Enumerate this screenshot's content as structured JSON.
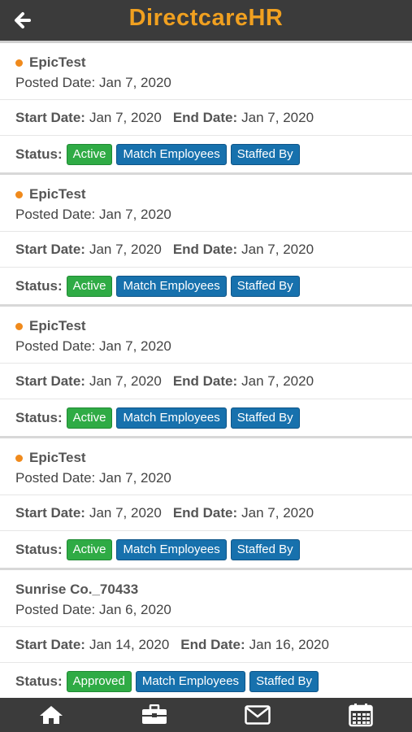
{
  "header": {
    "title": "DirectcareHR",
    "back_icon": "arrow-left-icon"
  },
  "labels": {
    "posted_prefix": "Posted Date:",
    "start_label": "Start Date:",
    "end_label": "End Date:",
    "status_label": "Status:",
    "match_employees": "Match Employees",
    "staffed_by": "Staffed By"
  },
  "jobs": [
    {
      "name": "EpicTest",
      "posted": "Jan 7, 2020",
      "start": "Jan 7, 2020",
      "end": "Jan 7, 2020",
      "status": "Active"
    },
    {
      "name": "EpicTest",
      "posted": "Jan 7, 2020",
      "start": "Jan 7, 2020",
      "end": "Jan 7, 2020",
      "status": "Active"
    },
    {
      "name": "EpicTest",
      "posted": "Jan 7, 2020",
      "start": "Jan 7, 2020",
      "end": "Jan 7, 2020",
      "status": "Active"
    },
    {
      "name": "EpicTest",
      "posted": "Jan 7, 2020",
      "start": "Jan 7, 2020",
      "end": "Jan 7, 2020",
      "status": "Active"
    },
    {
      "name": "Sunrise Co._70433",
      "posted": "Jan 6, 2020",
      "start": "Jan 14, 2020",
      "end": "Jan 16, 2020",
      "status": "Approved"
    }
  ],
  "nav": [
    "home-icon",
    "briefcase-icon",
    "mail-icon",
    "calendar-icon"
  ],
  "colors": {
    "accent": "#f0a020",
    "bar": "#3b3b3b",
    "green": "#2fab45",
    "blue": "#1771ad",
    "dot": "#f08a1c"
  }
}
